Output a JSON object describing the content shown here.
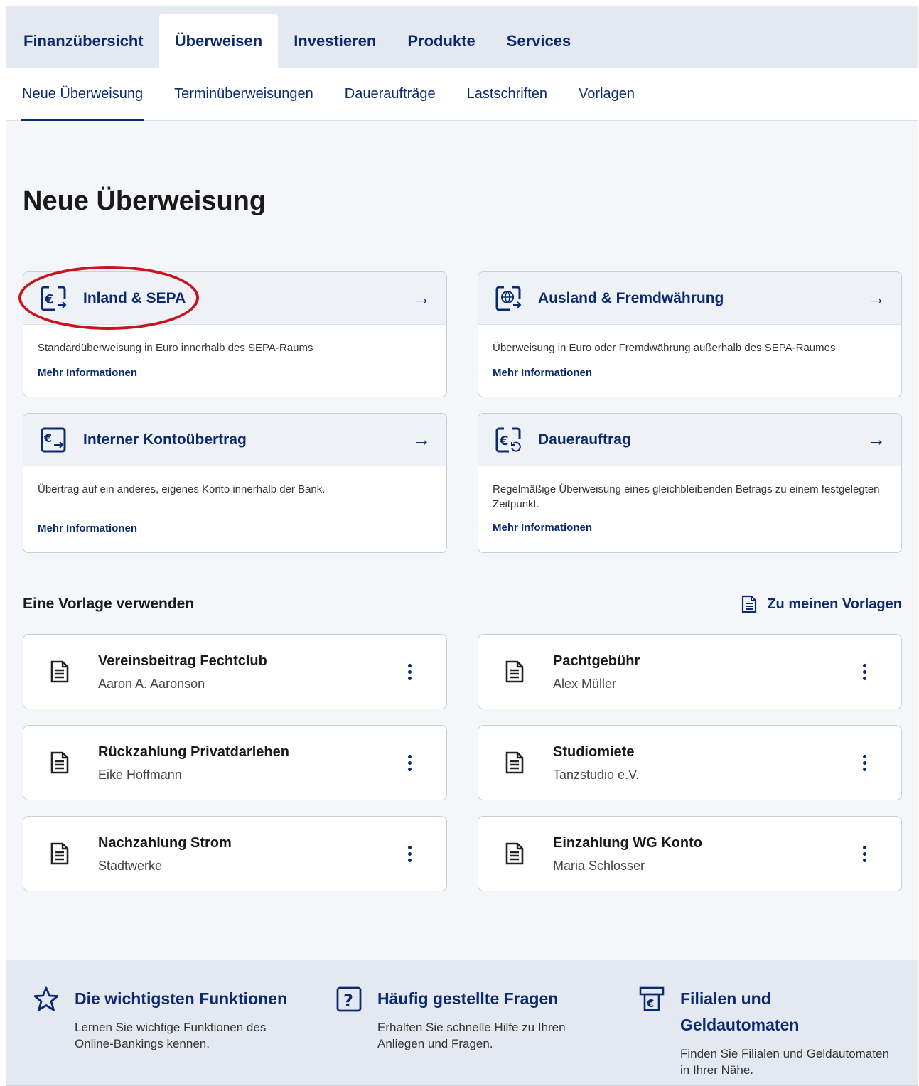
{
  "topnav": {
    "tabs": [
      {
        "label": "Finanzübersicht"
      },
      {
        "label": "Überweisen"
      },
      {
        "label": "Investieren"
      },
      {
        "label": "Produkte"
      },
      {
        "label": "Services"
      }
    ],
    "active": "Überweisen"
  },
  "subnav": {
    "items": [
      {
        "label": "Neue Überweisung"
      },
      {
        "label": "Terminüberweisungen"
      },
      {
        "label": "Daueraufträge"
      },
      {
        "label": "Lastschriften"
      },
      {
        "label": "Vorlagen"
      }
    ],
    "active": "Neue Überweisung"
  },
  "page": {
    "title": "Neue Überweisung"
  },
  "cards": [
    {
      "icon": "euro-transfer-icon",
      "title": "Inland & SEPA",
      "desc": "Standardüberweisung in Euro innerhalb des SEPA-Raums",
      "more": "Mehr Informationen"
    },
    {
      "icon": "globe-transfer-icon",
      "title": "Ausland & Fremdwährung",
      "desc": "Überweisung in Euro oder Fremdwährung außerhalb des SEPA-Raumes",
      "more": "Mehr Informationen"
    },
    {
      "icon": "internal-transfer-icon",
      "title": "Interner Kontoübertrag",
      "desc": "Übertrag auf ein anderes, eigenes Konto innerhalb der Bank.",
      "more": "Mehr Informationen"
    },
    {
      "icon": "standing-order-icon",
      "title": "Dauerauftrag",
      "desc": "Regelmäßige Überweisung eines gleichbleibenden Betrags zu einem festgelegten Zeitpunkt.",
      "more": "Mehr Informationen"
    }
  ],
  "templates": {
    "title": "Eine Vorlage verwenden",
    "link": "Zu meinen Vorlagen",
    "items": [
      {
        "name": "Vereinsbeitrag Fechtclub",
        "recipient": "Aaron A. Aaronson"
      },
      {
        "name": "Pachtgebühr",
        "recipient": "Alex Müller"
      },
      {
        "name": "Rückzahlung Privatdarlehen",
        "recipient": "Eike Hoffmann"
      },
      {
        "name": "Studiomiete",
        "recipient": "Tanzstudio e.V."
      },
      {
        "name": "Nachzahlung Strom",
        "recipient": "Stadtwerke"
      },
      {
        "name": "Einzahlung WG Konto",
        "recipient": "Maria Schlosser"
      }
    ]
  },
  "footer": [
    {
      "icon": "star-icon",
      "title": "Die wichtigsten Funktionen",
      "desc": "Lernen Sie wichtige Funktionen des Online-Bankings kennen."
    },
    {
      "icon": "question-icon",
      "title": "Häufig gestellte Fragen",
      "desc": "Erhalten Sie schnelle Hilfe zu Ihren Anliegen und Fragen."
    },
    {
      "icon": "atm-icon",
      "title": "Filialen und Geldautomaten",
      "desc": "Finden Sie Filialen und Geldautomaten in Ihrer Nähe."
    }
  ],
  "colors": {
    "brand": "#0b2a6f",
    "highlight": "#c8141e",
    "nav_bg": "#e4e9f1"
  }
}
